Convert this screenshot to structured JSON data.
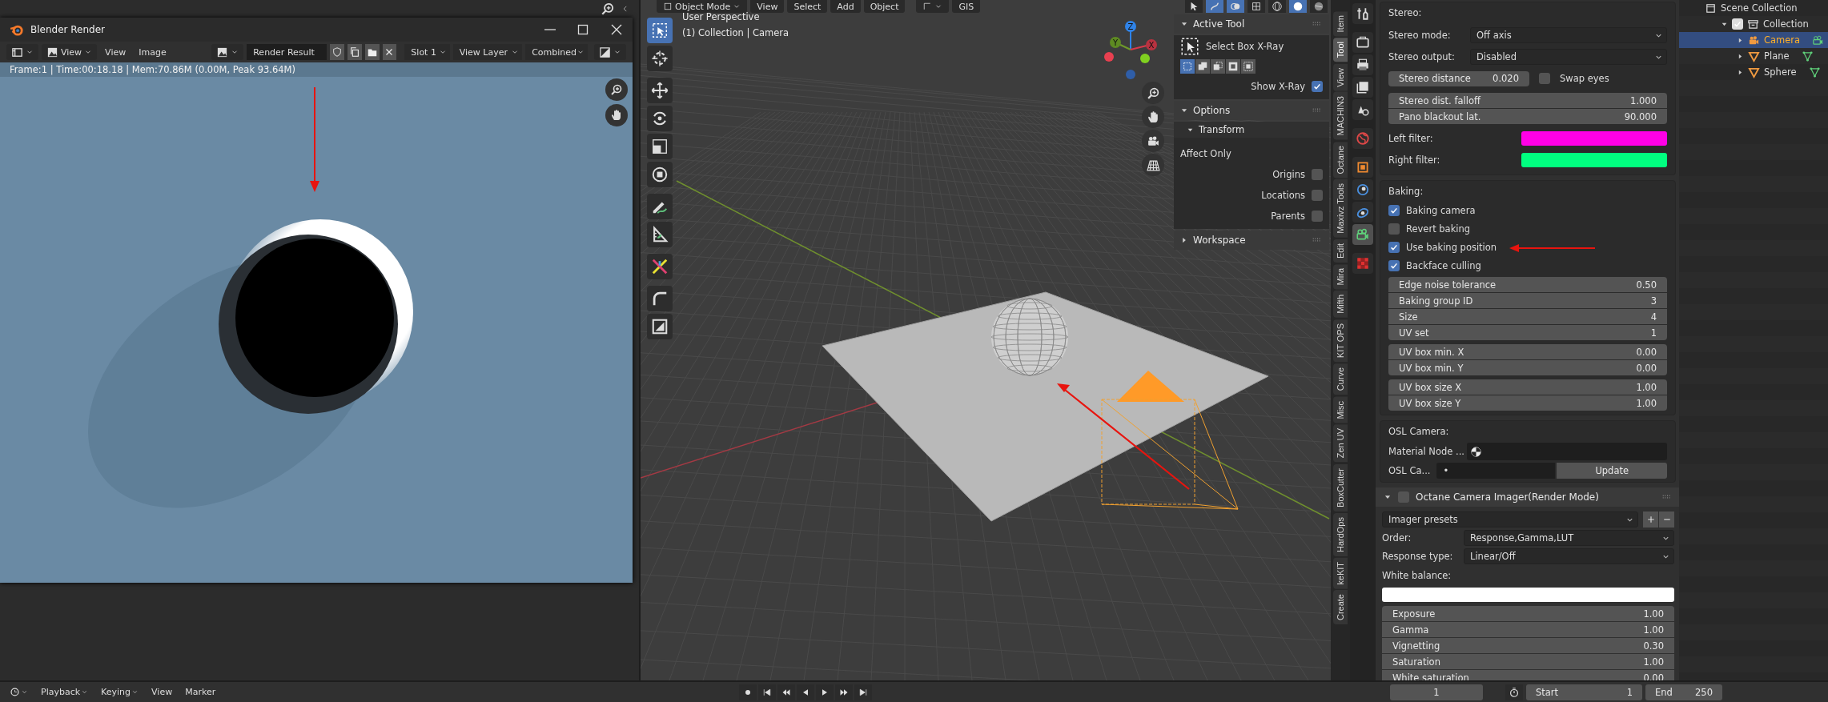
{
  "render_window": {
    "title": "Blender Render",
    "view_mode": "View",
    "menus": [
      "View",
      "Image"
    ],
    "image_name": "Render Result",
    "slot": "Slot 1",
    "view_layer": "View Layer",
    "render_pass": "Combined",
    "info": "Frame:1 | Time:00:18.18 | Mem:70.86M (0.00M, Peak 93.64M)"
  },
  "viewport": {
    "mode": "Object Mode",
    "menus": [
      "View",
      "Select",
      "Add",
      "Object"
    ],
    "addon_menu": "GIS",
    "overlay_lines": [
      "User Perspective",
      "(1) Collection | Camera"
    ],
    "axes": [
      "Z",
      "Y",
      "X"
    ],
    "tools": [
      {
        "selected": true
      },
      {
        "selected": false
      },
      {
        "selected": false
      },
      {
        "selected": false
      },
      {
        "selected": false
      },
      {
        "selected": false
      },
      {
        "selected": false
      },
      {
        "selected": false
      },
      {
        "selected": false
      },
      {
        "selected": false
      },
      {
        "selected": false
      }
    ]
  },
  "sidebar": {
    "panels": [
      {
        "kind": "active_tool",
        "title": "Active Tool",
        "expanded": true,
        "tool": "Select Box X-Ray",
        "modes": [
          {
            "selected": true
          },
          {
            "selected": false
          },
          {
            "selected": false
          },
          {
            "selected": false
          },
          {
            "selected": false
          }
        ],
        "option": {
          "label": "Show X-Ray",
          "checked": true
        }
      },
      {
        "kind": "options",
        "title": "Options",
        "expanded": true,
        "subpanel": {
          "title": "Transform",
          "expanded": true
        },
        "label": "Affect Only",
        "checkboxes": [
          {
            "label": "Origins",
            "checked": false
          },
          {
            "label": "Locations",
            "checked": false
          },
          {
            "label": "Parents",
            "checked": false
          }
        ]
      },
      {
        "title": "Workspace",
        "expanded": false
      }
    ]
  },
  "sidebar_tabs": [
    {
      "label": "Item",
      "selected": false
    },
    {
      "label": "Tool",
      "selected": true
    },
    {
      "label": "View",
      "selected": false
    },
    {
      "label": "MACHIN3",
      "selected": false
    },
    {
      "label": "Octane",
      "selected": false
    },
    {
      "label": "Maxivz Tools",
      "selected": false
    },
    {
      "label": "Edit",
      "selected": false
    },
    {
      "label": "Mira",
      "selected": false
    },
    {
      "label": "Mifth",
      "selected": false
    },
    {
      "label": "KIT OPS",
      "selected": false
    },
    {
      "label": "Curve",
      "selected": false
    },
    {
      "label": "Misc",
      "selected": false
    },
    {
      "label": "Zen UV",
      "selected": false
    },
    {
      "label": "BoxCutter",
      "selected": false
    },
    {
      "label": "HardOps",
      "selected": false
    },
    {
      "label": "keKIT",
      "selected": false
    },
    {
      "label": "Create",
      "selected": false
    }
  ],
  "properties": {
    "tabs": [
      {
        "selected": false
      },
      {
        "selected": false
      },
      {
        "selected": false
      },
      {
        "selected": false
      },
      {
        "selected": false
      },
      {
        "selected": false
      },
      {
        "selected": false
      },
      {
        "selected": false
      },
      {
        "selected": false
      },
      {
        "selected": true
      },
      {
        "selected": false
      }
    ],
    "sections": [
      {
        "kind": "box",
        "rows": [
          {
            "kind": "heading",
            "text": "Stereo:"
          },
          {
            "kind": "dropdown",
            "label": "Stereo mode:",
            "value": "Off axis"
          },
          {
            "kind": "dropdown",
            "label": "Stereo output:",
            "value": "Disabled"
          },
          {
            "kind": "number_check",
            "label": "Stereo distance",
            "value": "0.020",
            "check_label": "Swap eyes",
            "checked": false
          },
          {
            "kind": "numbers",
            "fields": [
              {
                "label": "Stereo dist. falloff",
                "value": "1.000"
              },
              {
                "label": "Pano blackout lat.",
                "value": "90.000"
              }
            ]
          },
          {
            "kind": "color",
            "label": "Left filter:",
            "color": "#ff00e6"
          },
          {
            "kind": "color",
            "label": "Right filter:",
            "color": "#00ff80"
          }
        ]
      },
      {
        "kind": "box",
        "rows": [
          {
            "kind": "heading",
            "text": "Baking:"
          },
          {
            "kind": "checkbox",
            "label": "Baking camera",
            "checked": true
          },
          {
            "kind": "checkbox",
            "label": "Revert baking",
            "checked": false
          },
          {
            "kind": "checkbox",
            "label": "Use baking position",
            "checked": true,
            "annotated": true
          },
          {
            "kind": "checkbox",
            "label": "Backface culling",
            "checked": true
          },
          {
            "kind": "numbers",
            "fields": [
              {
                "label": "Edge noise tolerance",
                "value": "0.50"
              },
              {
                "label": "Baking group ID",
                "value": "3"
              },
              {
                "label": "Size",
                "value": "4"
              },
              {
                "label": "UV set",
                "value": "1"
              }
            ]
          },
          {
            "kind": "numbers",
            "fields": [
              {
                "label": "UV box min. X",
                "value": "0.00"
              },
              {
                "label": "UV box min. Y",
                "value": "0.00"
              }
            ]
          },
          {
            "kind": "numbers",
            "fields": [
              {
                "label": "UV box size X",
                "value": "1.00"
              },
              {
                "label": "UV box size Y",
                "value": "1.00"
              }
            ]
          }
        ]
      },
      {
        "kind": "box",
        "rows": [
          {
            "kind": "heading",
            "text": "OSL Camera:"
          },
          {
            "kind": "node_field",
            "label": "Material Node ..."
          },
          {
            "kind": "text_button",
            "label": "OSL Ca...",
            "value": "•",
            "button": "Update"
          }
        ]
      },
      {
        "kind": "panel",
        "title": "Octane Camera Imager(Render Mode)",
        "enabled": false,
        "expanded": true,
        "rows": [
          {
            "kind": "preset",
            "value": "Imager presets"
          },
          {
            "kind": "dropdown",
            "label": "Order:",
            "value": "Response,Gamma,LUT"
          },
          {
            "kind": "dropdown",
            "label": "Response type:",
            "value": "Linear/Off"
          },
          {
            "kind": "heading",
            "text": "White balance:"
          },
          {
            "kind": "color",
            "color": "#ffffff"
          },
          {
            "kind": "numbers",
            "fields": [
              {
                "label": "Exposure",
                "value": "1.00"
              },
              {
                "label": "Gamma",
                "value": "1.00"
              },
              {
                "label": "Vignetting",
                "value": "0.30"
              },
              {
                "label": "Saturation",
                "value": "1.00"
              },
              {
                "label": "White saturation",
                "value": "0.00"
              }
            ]
          }
        ]
      }
    ]
  },
  "outliner": {
    "items": [
      {
        "label": "Scene Collection",
        "kind": "scene",
        "children": [
          {
            "label": "Collection",
            "kind": "collection",
            "checked": true,
            "expanded": true,
            "children": [
              {
                "label": "Camera",
                "kind": "camera",
                "selected": true,
                "expanded": false
              },
              {
                "label": "Plane",
                "kind": "mesh",
                "selected": false,
                "expanded": false
              },
              {
                "label": "Sphere",
                "kind": "mesh",
                "selected": false,
                "expanded": false
              }
            ]
          }
        ]
      }
    ]
  },
  "timeline": {
    "menus": [
      {
        "label": "Playback",
        "dropdown": true
      },
      {
        "label": "Keying",
        "dropdown": true
      },
      {
        "label": "View",
        "dropdown": false
      },
      {
        "label": "Marker",
        "dropdown": false
      }
    ],
    "current_frame": "1",
    "start_label": "Start",
    "start": "1",
    "end_label": "End",
    "end": "250"
  }
}
